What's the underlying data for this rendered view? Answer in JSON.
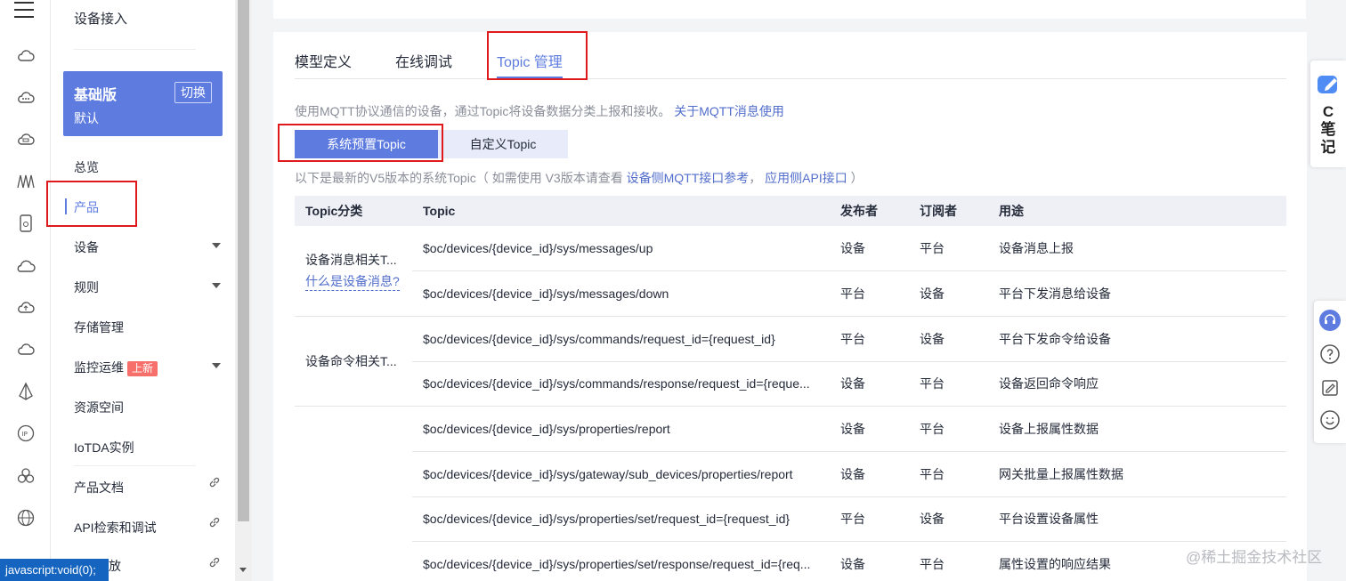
{
  "menu": {
    "title": "设备接入",
    "edition": {
      "name": "基础版",
      "default": "默认",
      "switch": "切换"
    },
    "items": {
      "overview": "总览",
      "product": "产品",
      "device": "设备",
      "rules": "规则",
      "storage": "存储管理",
      "monitor": "监控运维",
      "monitor_badge": "上新",
      "resource_space": "资源空间",
      "iotda_instance": "IoTDA实例",
      "product_docs": "产品文档",
      "api_explorer": "API检索和调试",
      "partial_item": "放"
    }
  },
  "tabs": [
    "模型定义",
    "在线调试",
    "Topic 管理"
  ],
  "description": "使用MQTT协议通信的设备，通过Topic将设备数据分类上报和接收。",
  "description_link": "关于MQTT消息使用",
  "buttons": {
    "system": "系统预置Topic",
    "custom": "自定义Topic"
  },
  "note": {
    "prefix": "以下是最新的V5版本的系统Topic（ 如需使用 V3版本请查看",
    "link1": "设备侧MQTT接口参考",
    "sep": "，",
    "link2": "应用侧API接口",
    "suffix": "）"
  },
  "table": {
    "headers": [
      "Topic分类",
      "Topic",
      "发布者",
      "订阅者",
      "用途"
    ],
    "cat1": "设备消息相关T...",
    "cat1_help": "什么是设备消息?",
    "cat2": "设备命令相关T...",
    "rows": [
      {
        "topic": "$oc/devices/{device_id}/sys/messages/up",
        "pub": "设备",
        "sub": "平台",
        "use": "设备消息上报"
      },
      {
        "topic": "$oc/devices/{device_id}/sys/messages/down",
        "pub": "平台",
        "sub": "设备",
        "use": "平台下发消息给设备"
      },
      {
        "topic": "$oc/devices/{device_id}/sys/commands/request_id={request_id}",
        "pub": "平台",
        "sub": "设备",
        "use": "平台下发命令给设备"
      },
      {
        "topic": "$oc/devices/{device_id}/sys/commands/response/request_id={reque...",
        "pub": "设备",
        "sub": "平台",
        "use": "设备返回命令响应"
      },
      {
        "topic": "$oc/devices/{device_id}/sys/properties/report",
        "pub": "设备",
        "sub": "平台",
        "use": "设备上报属性数据"
      },
      {
        "topic": "$oc/devices/{device_id}/sys/gateway/sub_devices/properties/report",
        "pub": "设备",
        "sub": "平台",
        "use": "网关批量上报属性数据"
      },
      {
        "topic": "$oc/devices/{device_id}/sys/properties/set/request_id={request_id}",
        "pub": "平台",
        "sub": "设备",
        "use": "平台设置设备属性"
      },
      {
        "topic": "$oc/devices/{device_id}/sys/properties/set/response/request_id={req...",
        "pub": "设备",
        "sub": "平台",
        "use": "属性设置的响应结果"
      }
    ]
  },
  "side_widget": {
    "text": "C笔记"
  },
  "status_bar": "javascript:void(0);",
  "watermark": "@稀土掘金技术社区",
  "colors": {
    "accent": "#5e7ce0",
    "highlight_box": "#e0191d",
    "badge": "#f66f6a"
  }
}
